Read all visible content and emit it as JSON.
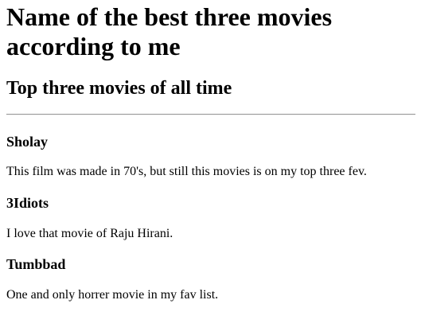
{
  "page": {
    "heading": "Name of the best three movies according to me",
    "subheading": "Top three movies of all time"
  },
  "movies": [
    {
      "title": "Sholay",
      "description": "This film was made in 70's, but still this movies is on my top three fev."
    },
    {
      "title": "3Idiots",
      "description": "I love that movie of Raju Hirani."
    },
    {
      "title": "Tumbbad",
      "description": "One and only horrer movie in my fav list."
    }
  ]
}
